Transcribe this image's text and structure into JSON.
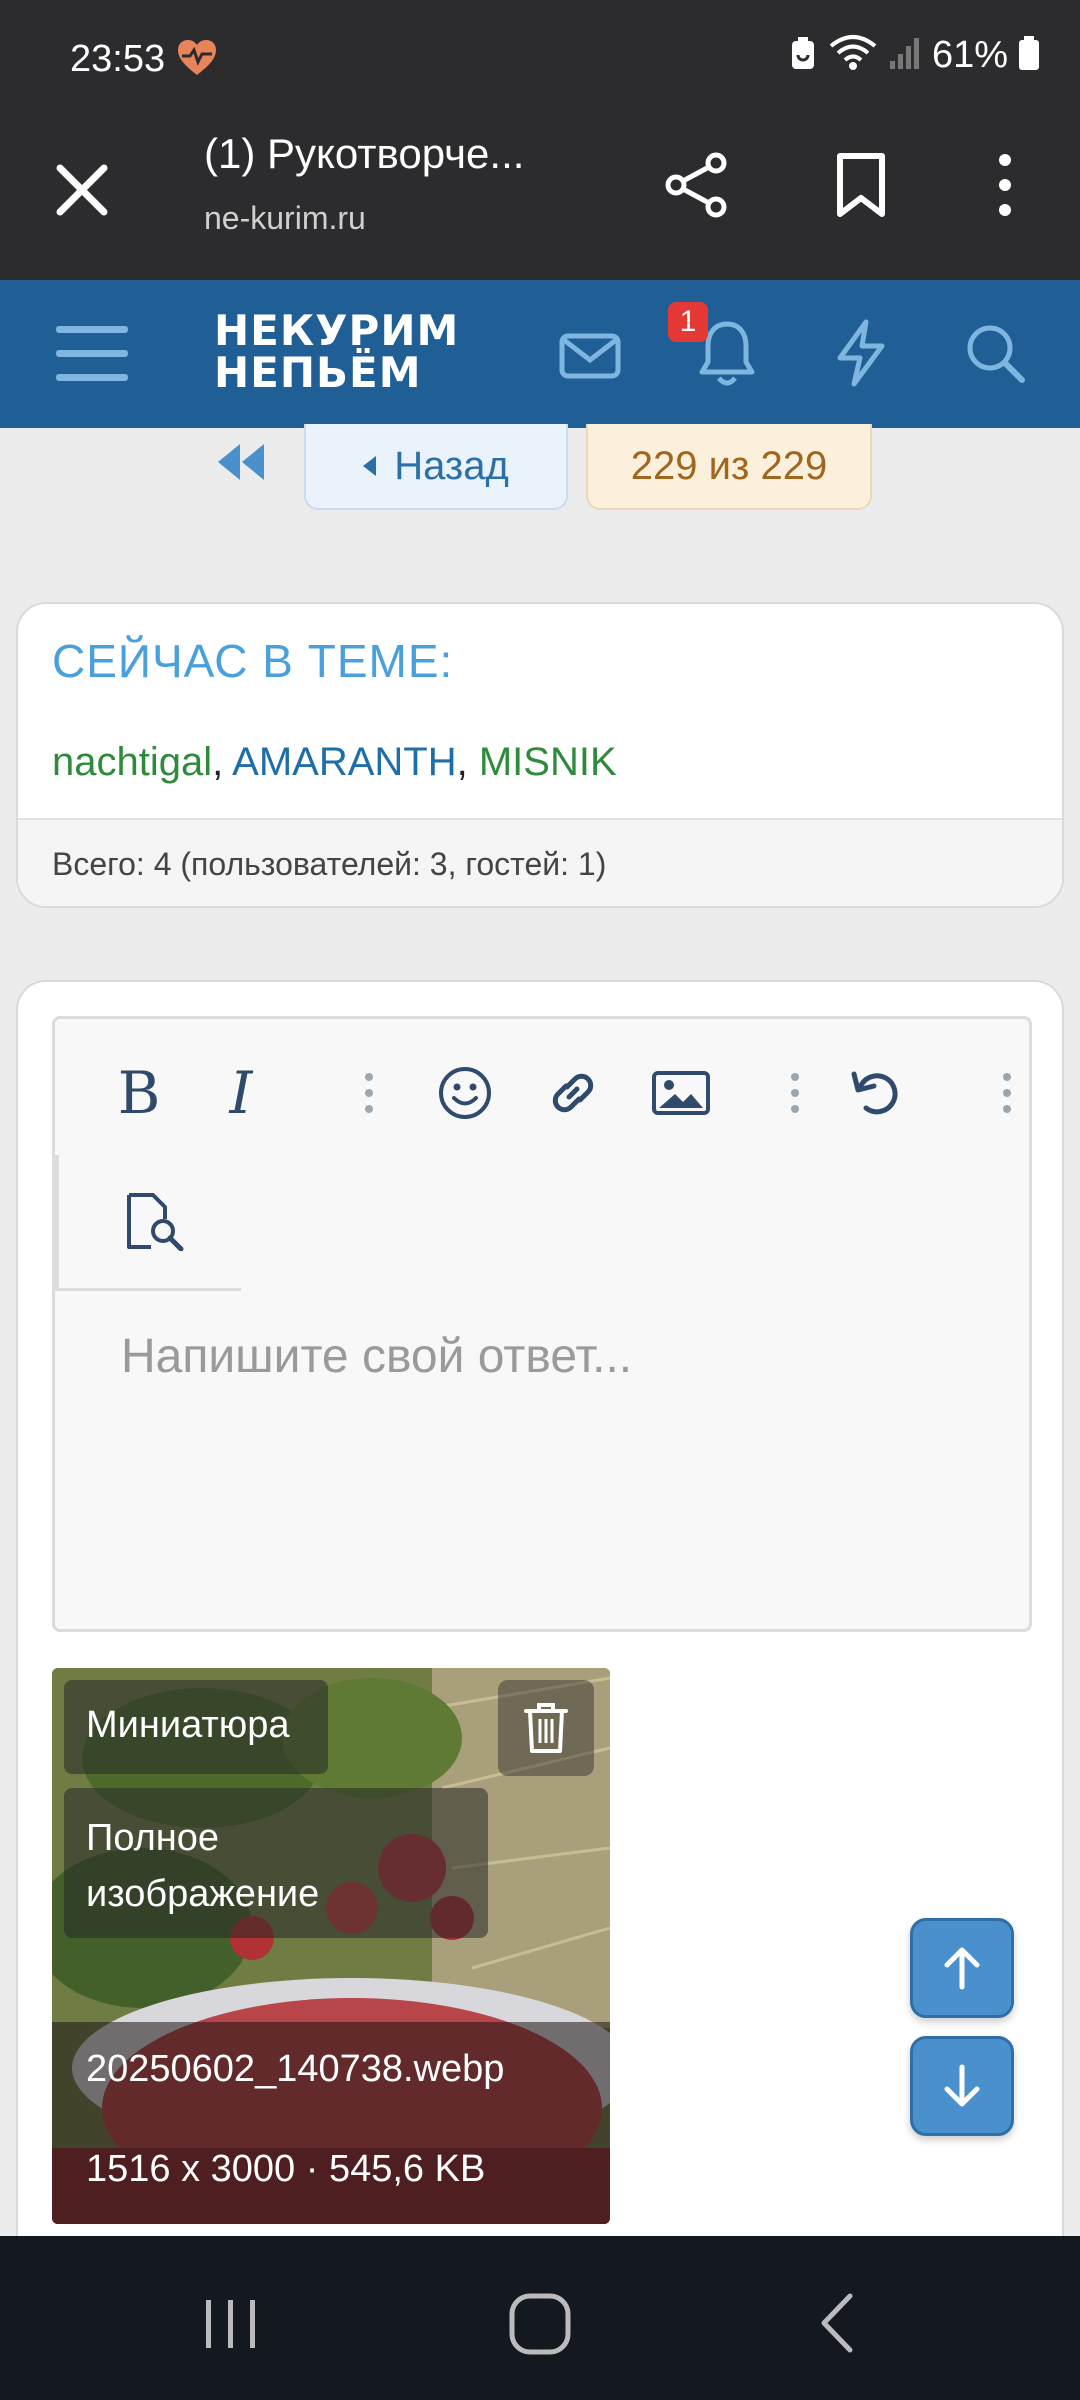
{
  "status_bar": {
    "time": "23:53",
    "battery": "61%",
    "icons": [
      "heart-rate-icon",
      "battery-saver-icon",
      "wifi-icon",
      "signal-icon",
      "battery-icon"
    ]
  },
  "browser": {
    "tab_title": "(1) Рукотворче...",
    "url": "ne-kurim.ru",
    "icons": [
      "close-icon",
      "share-icon",
      "bookmark-icon",
      "more-vert-icon"
    ]
  },
  "site_nav": {
    "logo_line1": "НЕКУРИМ",
    "logo_line2": "НЕПЬЁМ",
    "notification_count": "1",
    "icons": [
      "menu-icon",
      "mail-icon",
      "bell-icon",
      "flash-icon",
      "search-icon"
    ]
  },
  "pagination": {
    "back_label": "Назад",
    "page_count": "229 из 229"
  },
  "online": {
    "title": "СЕЙЧАС В ТЕМЕ:",
    "users": [
      {
        "name": "nachtigal",
        "color": "#2e8b3c"
      },
      {
        "name": "AMARANTH",
        "color": "#1f6ea8"
      },
      {
        "name": "MISNIK",
        "color": "#2e8b3c"
      }
    ],
    "separator": ", ",
    "total": "Всего: 4 (пользователей: 3, гостей: 1)"
  },
  "editor": {
    "bold_glyph": "B",
    "italic_glyph": "I",
    "placeholder": "Напишите свой ответ...",
    "icons": [
      "bold-icon",
      "italic-icon",
      "more-icon",
      "emoji-icon",
      "link-icon",
      "image-icon",
      "more-icon",
      "undo-icon",
      "more-icon",
      "preview-icon"
    ]
  },
  "attachment": {
    "thumb_label": "Миниатюра",
    "full_label_line1": "Полное",
    "full_label_line2": "изображение",
    "filename": "20250602_140738.webp",
    "meta": "1516 x 3000 · 545,6 KB"
  },
  "colors": {
    "site_nav": "#1f5f96",
    "accent_blue": "#4aa0dc",
    "user_green": "#2e8b3c",
    "user_blue": "#1f6ea8",
    "badge_red": "#e53935",
    "scroll_button": "#4a90cc"
  }
}
